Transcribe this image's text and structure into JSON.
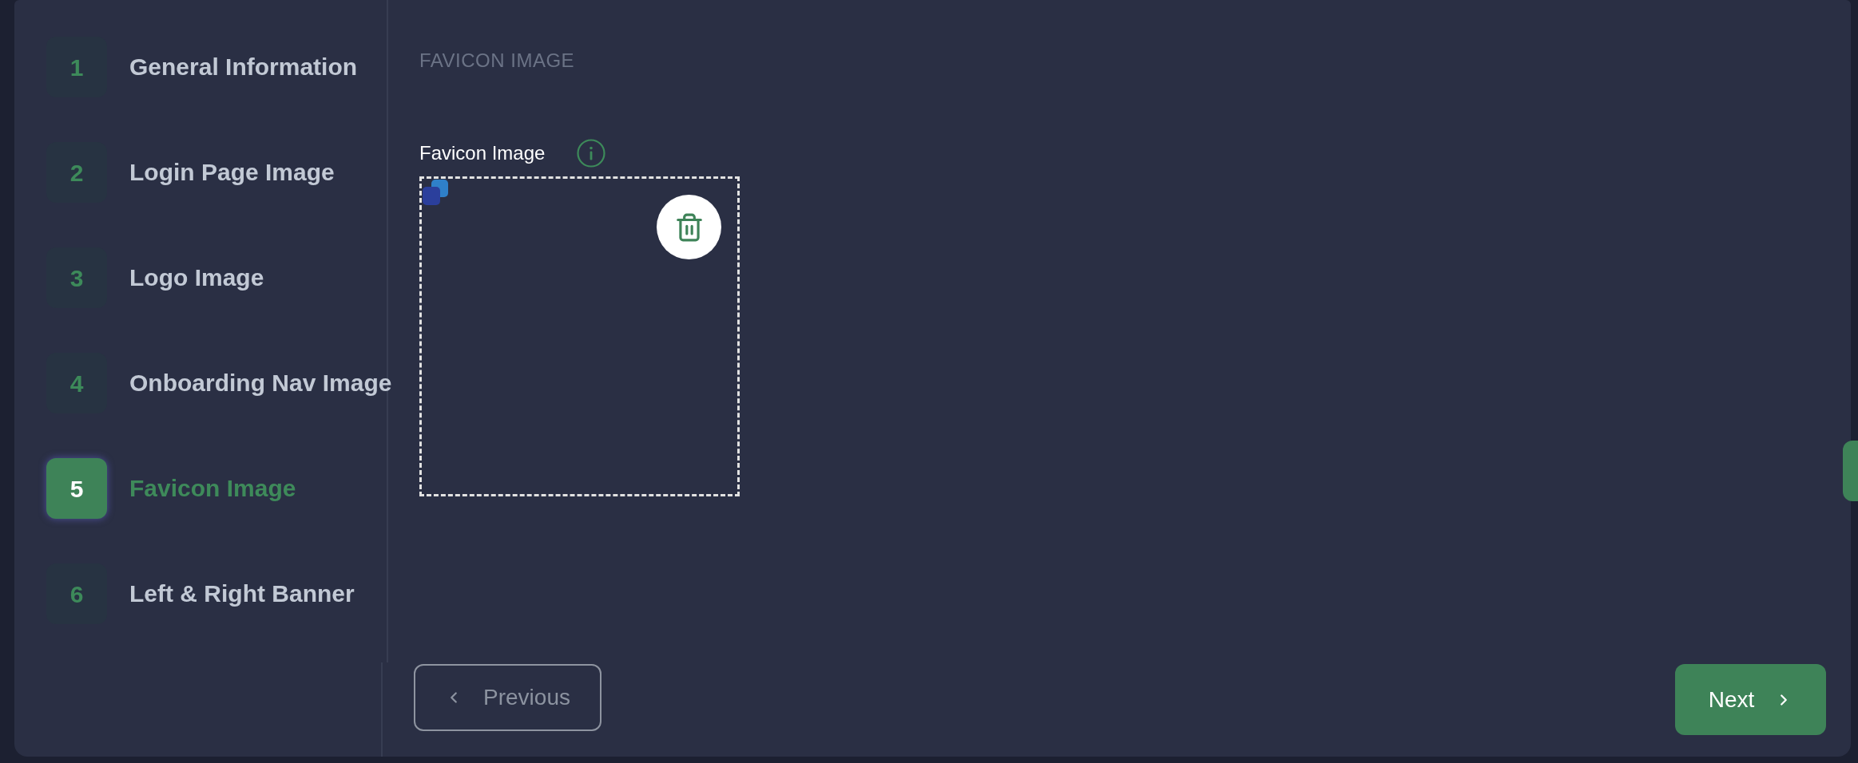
{
  "steps": [
    {
      "number": "1",
      "label": "General Information",
      "selected": false
    },
    {
      "number": "2",
      "label": "Login Page Image",
      "selected": false
    },
    {
      "number": "3",
      "label": "Logo Image",
      "selected": false
    },
    {
      "number": "4",
      "label": "Onboarding Nav Image",
      "selected": false
    },
    {
      "number": "5",
      "label": "Favicon Image",
      "selected": true
    },
    {
      "number": "6",
      "label": "Left & Right Banner",
      "selected": false
    }
  ],
  "section": {
    "title": "FAVICON IMAGE",
    "field": {
      "label": "Favicon Image"
    }
  },
  "buttons": [
    {
      "label": "Previous",
      "kind": "back"
    },
    {
      "label": "Next",
      "kind": "forward"
    }
  ]
}
